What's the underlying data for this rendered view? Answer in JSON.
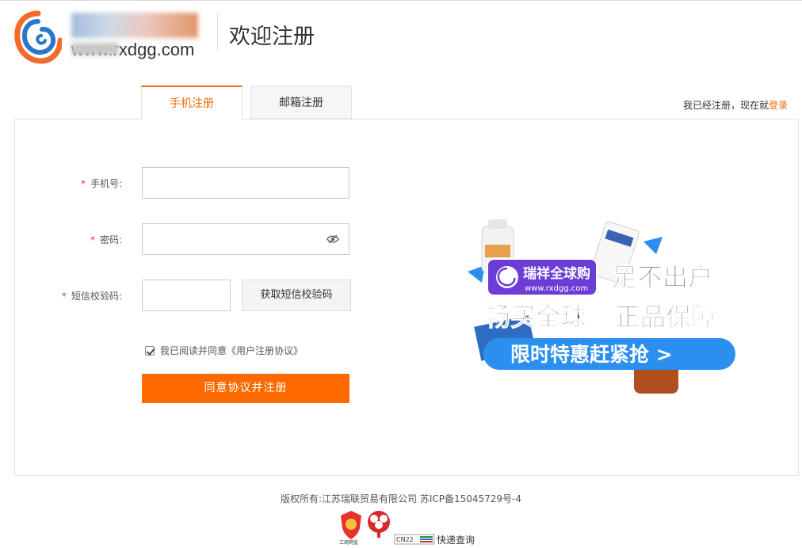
{
  "header": {
    "domain": "www.rxdgg.com",
    "page_heading": "欢迎注册"
  },
  "tabs": [
    {
      "label": "手机注册",
      "active": true
    },
    {
      "label": "邮箱注册",
      "active": false
    }
  ],
  "login_hint": {
    "text": "我已经注册，现在就",
    "link": "登录"
  },
  "form": {
    "required_mark": "*",
    "phone_label": "手机号:",
    "phone_value": "",
    "password_label": "密码:",
    "password_value": "",
    "sms_label": "短信校验码:",
    "sms_value": "",
    "sms_button": "获取短信校验码",
    "agree_text": "我已阅读并同意《用户注册协议》",
    "agree_checked": true,
    "submit_label": "同意协议并注册"
  },
  "promo": {
    "brand_name": "瑞祥全球购",
    "brand_url": "www.rxdgg.com",
    "slogan_1": "足不出户",
    "slogan_2": "畅买全球",
    "slogan_3": "正品保障",
    "cta": "限时特惠赶紧抢 >"
  },
  "footer": {
    "copyright": "版权所有:江苏瑞联贸易有限公司 苏ICP备15045729号-4",
    "badge_1": "工商网监",
    "badge_3": "CN22",
    "express": "快递查询"
  },
  "colors": {
    "accent": "#ff6a00",
    "link": "#f56a0e",
    "required": "#e4393c",
    "promo_blue": "#2b8ff0",
    "promo_purple": "#6c3cd6"
  },
  "icons": [
    "swirl-logo-icon",
    "eye-toggle-icon",
    "check-icon",
    "shield-badge-icon",
    "tree-badge-icon",
    "cn22-badge-icon"
  ]
}
